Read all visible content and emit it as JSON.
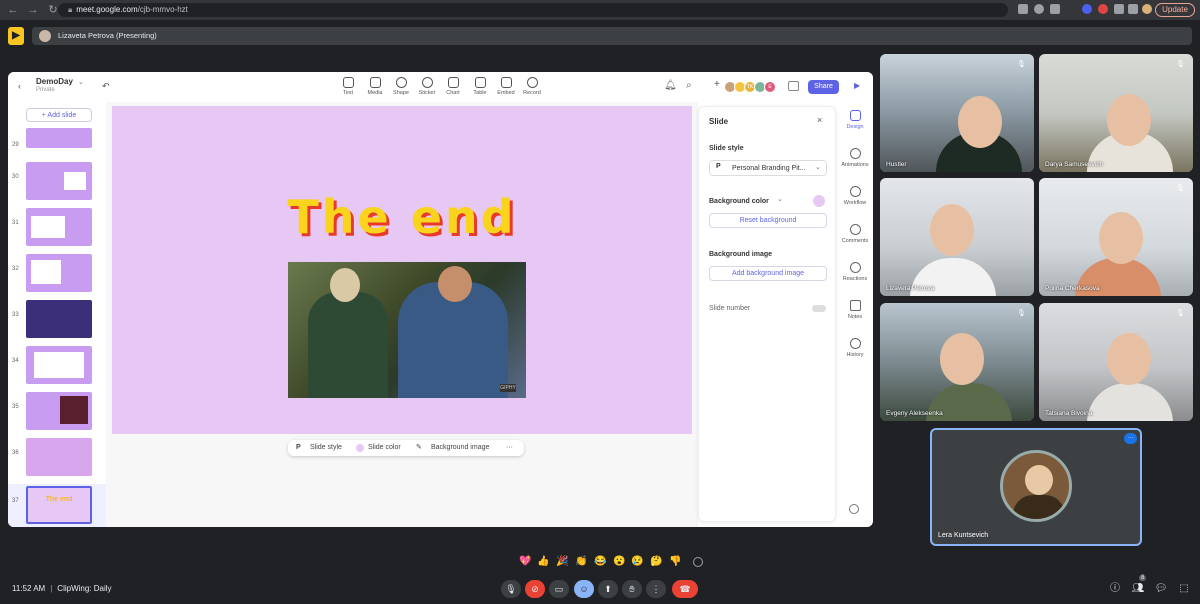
{
  "browser": {
    "url_host": "meet.google.com",
    "url_path": "/cjb-mmvo-hzt",
    "update_label": "Update"
  },
  "meet": {
    "presenting_label": "Lizaveta Petrova (Presenting)",
    "clock": "11:52 AM",
    "separator": "|",
    "meeting_name": "ClipWing: Daily",
    "participants_count": "8"
  },
  "editor": {
    "deck_title": "DemoDay",
    "deck_subtitle": "Private",
    "tools": [
      "Text",
      "Media",
      "Shape",
      "Sticker",
      "Chart",
      "Table",
      "Embed",
      "Record"
    ],
    "share_label": "Share",
    "collab_initials": [
      "TK",
      "E"
    ],
    "add_slide_label": "Add slide",
    "slide_numbers": [
      "29",
      "30",
      "31",
      "32",
      "33",
      "34",
      "35",
      "36",
      "37"
    ],
    "current_slide_text": "The end",
    "thumb_37_text": "The end",
    "gif_badge": "GIPHY",
    "bottom_toolbar": {
      "style_label": "Slide style",
      "color_label": "Slide color",
      "bg_label": "Background image",
      "more": "···"
    }
  },
  "panel": {
    "title": "Slide",
    "slide_style_label": "Slide style",
    "slide_style_value": "Personal Branding Pit...",
    "bg_color_label": "Background color",
    "reset_bg_label": "Reset background",
    "bg_image_label": "Background image",
    "add_bg_image_label": "Add background image",
    "slide_number_label": "Slide number",
    "bg_color": "#e7c8f4"
  },
  "rail": [
    "Design",
    "Animations",
    "Workflow",
    "Comments",
    "Reactions",
    "Notes",
    "History"
  ],
  "participants": [
    {
      "name": "Hustler"
    },
    {
      "name": "Darya Samuseevich"
    },
    {
      "name": "Lizaveta Petrova"
    },
    {
      "name": "Polina Cherkasova"
    },
    {
      "name": "Evgeny Alekseenka"
    },
    {
      "name": "Tatsiana Bivoina"
    }
  ],
  "pinned": {
    "name": "Lera Kuntsevich",
    "badge": "···"
  },
  "reactions": [
    "💖",
    "👍",
    "🎉",
    "👏",
    "😂",
    "😮",
    "😢",
    "🤔",
    "👎"
  ]
}
